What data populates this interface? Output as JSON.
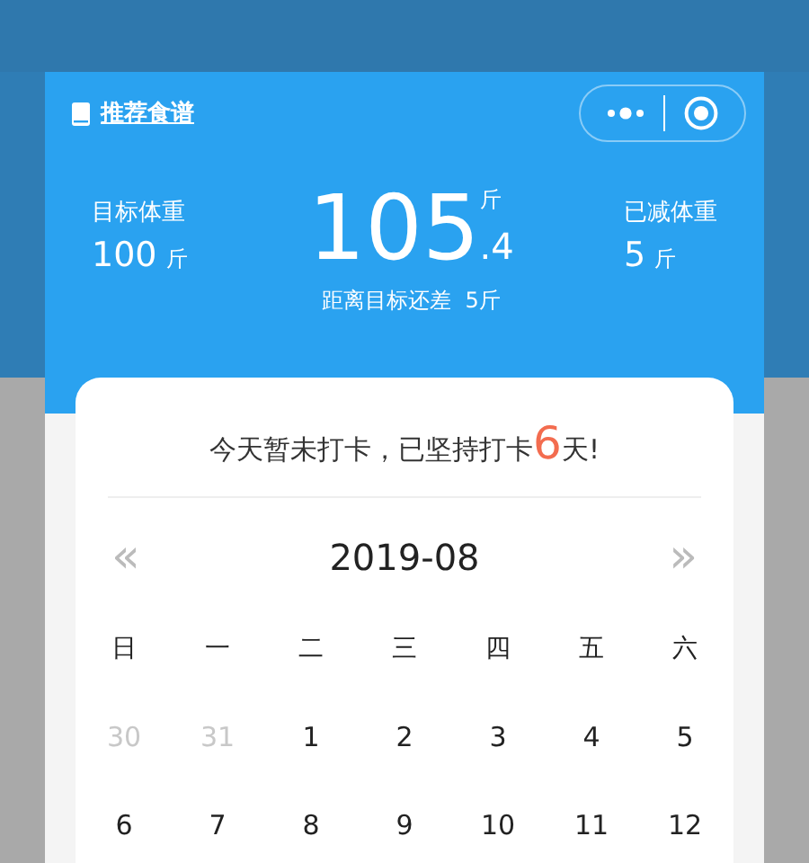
{
  "header": {
    "recipe_link": "推荐食谱",
    "target": {
      "label": "目标体重",
      "value": "100",
      "unit": "斤"
    },
    "current": {
      "integer": "105",
      "decimal": ".4",
      "unit": "斤"
    },
    "lost": {
      "label": "已减体重",
      "value": "5",
      "unit": "斤"
    },
    "remaining": {
      "label": "距离目标还差",
      "value": "5斤"
    }
  },
  "checkin": {
    "prefix": "今天暂未打卡，已坚持打卡",
    "count": "6",
    "suffix": "天!"
  },
  "calendar": {
    "prev": "«",
    "month": "2019-08",
    "next": "»",
    "weekdays": [
      "日",
      "一",
      "二",
      "三",
      "四",
      "五",
      "六"
    ],
    "days": [
      {
        "label": "30",
        "in_month": false
      },
      {
        "label": "31",
        "in_month": false
      },
      {
        "label": "1",
        "in_month": true
      },
      {
        "label": "2",
        "in_month": true
      },
      {
        "label": "3",
        "in_month": true
      },
      {
        "label": "4",
        "in_month": true
      },
      {
        "label": "5",
        "in_month": true
      },
      {
        "label": "6",
        "in_month": true
      },
      {
        "label": "7",
        "in_month": true
      },
      {
        "label": "8",
        "in_month": true
      },
      {
        "label": "9",
        "in_month": true
      },
      {
        "label": "10",
        "in_month": true
      },
      {
        "label": "11",
        "in_month": true
      },
      {
        "label": "12",
        "in_month": true
      }
    ]
  }
}
